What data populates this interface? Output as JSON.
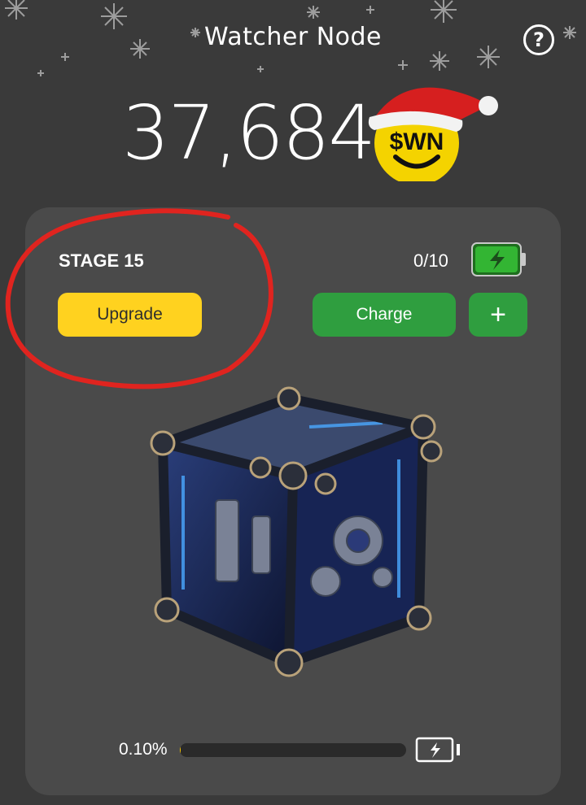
{
  "header": {
    "title": "Watcher Node",
    "help_icon": "help-icon"
  },
  "balance": {
    "amount": "37,684",
    "token_symbol": "$WN",
    "coin_icon": "smiley-coin-santa-hat-icon"
  },
  "node": {
    "stage_label": "STAGE 15",
    "charge_count": "0/10",
    "battery_icon": "battery-charging-icon",
    "upgrade_label": "Upgrade",
    "charge_label": "Charge",
    "add_label": "+",
    "image": "mechanical-cube-illustration"
  },
  "progress": {
    "percent_text": "0.10%",
    "value": 0.001,
    "energy_icon": "battery-bolt-icon"
  },
  "colors": {
    "background": "#3a3a3a",
    "card": "#4a4a4a",
    "upgrade": "#ffd21f",
    "charge": "#2f9e3f",
    "annotation": "#e0241f"
  }
}
